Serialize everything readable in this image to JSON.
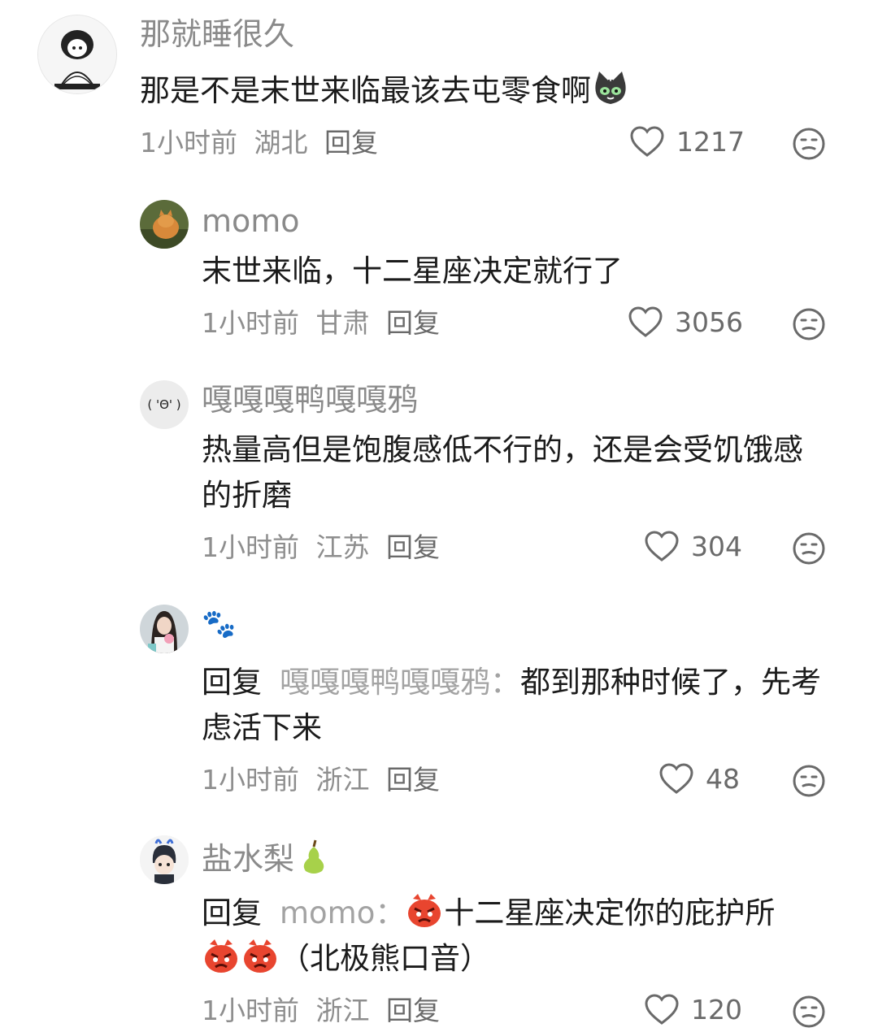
{
  "comments": [
    {
      "username": "那就睡很久",
      "text": "那是不是末世来临最该去屯零食啊",
      "time": "1小时前",
      "location": "湖北",
      "reply_label": "回复",
      "likes": "1217",
      "avatar_icon": "girl-sketch-avatar",
      "trailing_emoji": "cat-face-emoji"
    },
    {
      "username": "momo",
      "text": "末世来临，十二星座决定就行了",
      "time": "1小时前",
      "location": "甘肃",
      "reply_label": "回复",
      "likes": "3056",
      "avatar_icon": "cat-photo-avatar"
    },
    {
      "username": "嘎嘎嘎鸭嘎嘎鸦",
      "text": "热量高但是饱腹感低不行的，还是会受饥饿感的折磨",
      "time": "1小时前",
      "location": "江苏",
      "reply_label": "回复",
      "likes": "304",
      "avatar_text": "( 'Θ' )"
    },
    {
      "username": "🐾",
      "reply_prefix": "回复",
      "reply_target": "嘎嘎嘎鸭嘎嘎鸦：",
      "text": "都到那种时候了，先考虑活下来",
      "time": "1小时前",
      "location": "浙江",
      "reply_label": "回复",
      "likes": "48",
      "avatar_icon": "girl-photo-avatar"
    },
    {
      "username": "盐水梨",
      "username_emoji": "pear-emoji",
      "reply_prefix": "回复",
      "reply_target": "momo：",
      "text": "十二星座决定你的庇护所",
      "text_tail": "（北极熊口音）",
      "time": "1小时前",
      "location": "浙江",
      "reply_label": "回复",
      "likes": "120",
      "avatar_icon": "anime-boy-avatar",
      "inline_emoji": "angry-face-emoji"
    }
  ],
  "colors": {
    "username": "#8a8a8a",
    "text": "#1b1b1b",
    "meta": "#8e8e8e",
    "icon": "#6a6a6a"
  }
}
